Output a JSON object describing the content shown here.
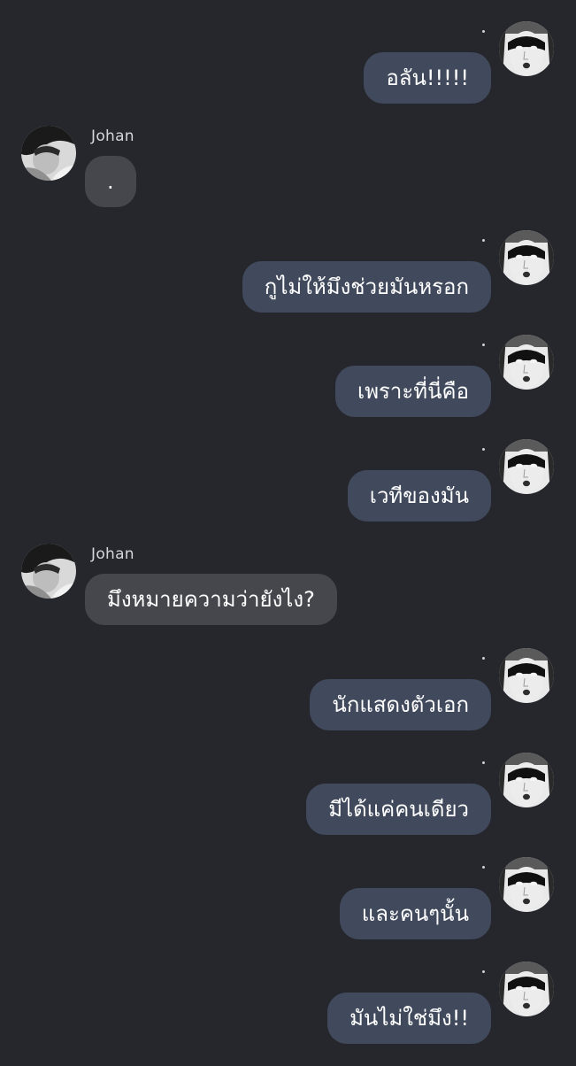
{
  "colors": {
    "background": "#26272d",
    "outgoing_bubble": "#414a5d",
    "incoming_bubble": "#45474d",
    "text": "#ffffff"
  },
  "messages": [
    {
      "side": "out",
      "text": "อลัน!!!!!",
      "avatar": "masked-face-avatar"
    },
    {
      "side": "in",
      "sender": "Johan",
      "text": ".",
      "avatar": "johan-avatar"
    },
    {
      "side": "out",
      "text": "กูไม่ให้มึงช่วยมันหรอก",
      "avatar": "masked-face-avatar"
    },
    {
      "side": "out",
      "text": "เพราะที่นี่คือ",
      "avatar": "masked-face-avatar"
    },
    {
      "side": "out",
      "text": "เวทีของมัน",
      "avatar": "masked-face-avatar"
    },
    {
      "side": "in",
      "sender": "Johan",
      "text": "มึงหมายความว่ายังไง?",
      "avatar": "johan-avatar"
    },
    {
      "side": "out",
      "text": "นักแสดงตัวเอก",
      "avatar": "masked-face-avatar"
    },
    {
      "side": "out",
      "text": "มีได้แค่คนเดียว",
      "avatar": "masked-face-avatar"
    },
    {
      "side": "out",
      "text": "และคนๆนั้น",
      "avatar": "masked-face-avatar"
    },
    {
      "side": "out",
      "text": "มันไม่ใช่มึง!!",
      "avatar": "masked-face-avatar"
    }
  ]
}
